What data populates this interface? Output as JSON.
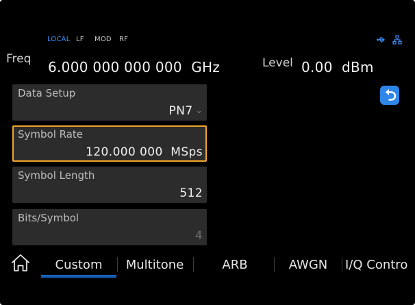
{
  "status": {
    "indicators": [
      {
        "label": "LOCAL",
        "color": "#3f8ef5"
      },
      {
        "label": "LF",
        "color": "#c8c8c8"
      },
      {
        "label": "MOD",
        "color": "#c8c8c8"
      },
      {
        "label": "RF",
        "color": "#c8c8c8"
      }
    ],
    "icons": [
      "usb-icon",
      "network-icon"
    ]
  },
  "header": {
    "freq_label": "Freq",
    "freq_value": "6.000 000 000 000  GHz",
    "level_label": "Level",
    "level_value": "0.00  dBm"
  },
  "params": [
    {
      "label": "Data Setup",
      "value": "PN7",
      "has_dropdown": true
    },
    {
      "label": "Symbol Rate",
      "value": "120.000 000  MSps",
      "selected": true
    },
    {
      "label": "Symbol Length",
      "value": "512"
    },
    {
      "label": "Bits/Symbol",
      "value": "4",
      "disabled": true
    }
  ],
  "back_button": {
    "icon": "back-arrow-icon",
    "color": "#2e86e8"
  },
  "tabs": [
    {
      "label": "Custom",
      "active": true
    },
    {
      "label": "Multitone"
    },
    {
      "label": "ARB"
    },
    {
      "label": "AWGN"
    },
    {
      "label": "I/Q Contro"
    }
  ],
  "home_icon": "home-icon",
  "colors": {
    "accent": "#2e86e8",
    "selection": "#f2a52a",
    "background": "#000000",
    "panel": "#2c2c2c"
  }
}
